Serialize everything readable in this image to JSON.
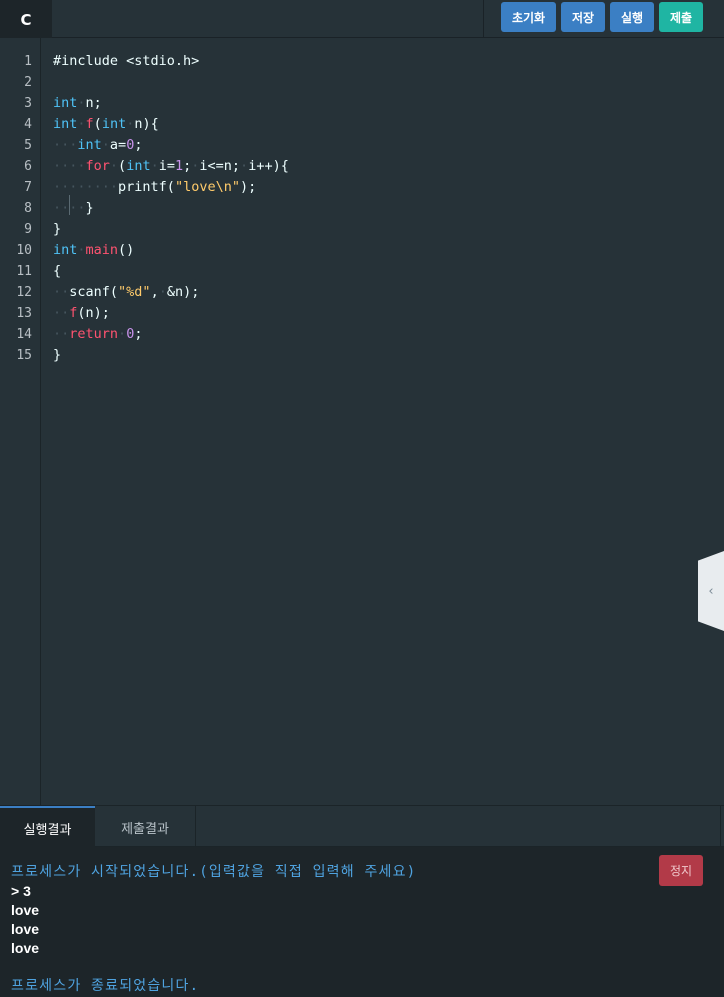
{
  "toolbar": {
    "language_tab": "C",
    "reset_label": "초기화",
    "save_label": "저장",
    "run_label": "실행",
    "submit_label": "제출"
  },
  "editor": {
    "line_numbers": [
      "1",
      "2",
      "3",
      "4",
      "5",
      "6",
      "7",
      "8",
      "9",
      "10",
      "11",
      "12",
      "13",
      "14",
      "15"
    ],
    "code_lines": [
      "#include <stdio.h>",
      "",
      "int n;",
      "int f(int n){",
      "   int a=0;",
      "    for (int i=1; i<=n; i++){",
      "        printf(\"love\\n\");",
      "    }",
      "}",
      "int main()",
      "{",
      "  scanf(\"%d\", &n);",
      "  f(n);",
      "  return 0;",
      "}"
    ]
  },
  "side_handle": {
    "icon": "chevron-left-icon",
    "glyph": "‹"
  },
  "result": {
    "tabs": [
      {
        "label": "실행결과",
        "active": true
      },
      {
        "label": "제출결과",
        "active": false
      }
    ],
    "stop_label": "정지",
    "console_lines": [
      "프로세스가 시작되었습니다.(입력값을 직접 입력해 주세요)",
      "> 3",
      "love",
      "love",
      "love",
      "",
      "프로세스가 종료되었습니다."
    ]
  },
  "colors": {
    "background": "#263238",
    "console_background": "#1d2529",
    "button_blue": "#3b7fc4",
    "button_teal": "#1fb5a3",
    "stop_red": "#b23a48",
    "system_text": "#4fa3e0"
  }
}
